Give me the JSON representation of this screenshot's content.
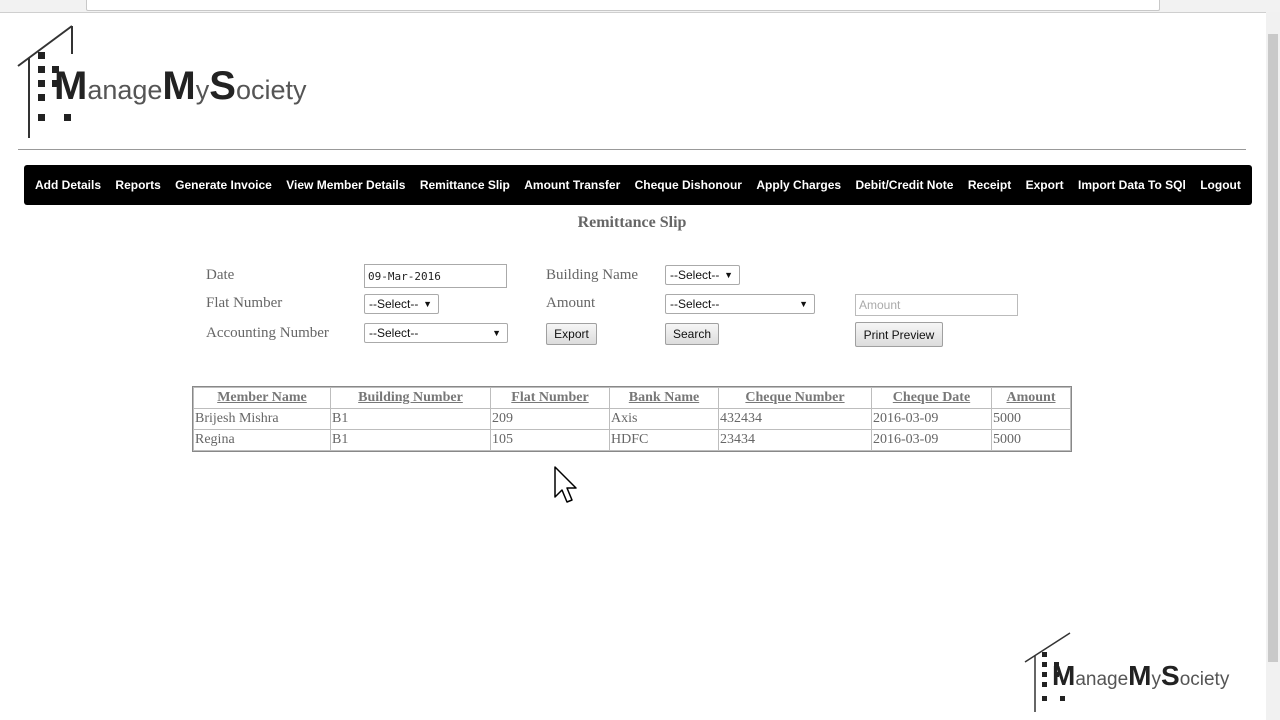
{
  "app": {
    "logo_part1": "anage",
    "logo_part2": "y",
    "logo_part3": "ociety"
  },
  "nav": {
    "items": [
      "Add Details",
      "Reports",
      "Generate Invoice",
      "View Member Details",
      "Remittance Slip",
      "Amount Transfer",
      "Cheque Dishonour",
      "Apply Charges",
      "Debit/Credit Note",
      "Receipt",
      "Export",
      "Import Data To SQl",
      "Logout"
    ]
  },
  "page": {
    "title": "Remittance Slip"
  },
  "form": {
    "date_label": "Date",
    "date_value": "09-Mar-2016",
    "building_label": "Building Name",
    "building_value": "--Select--",
    "flat_label": "Flat Number",
    "flat_value": "--Select--",
    "amount_label": "Amount",
    "amount_select_value": "--Select--",
    "amount_placeholder": "Amount",
    "accounting_label": "Accounting Number",
    "accounting_value": "--Select--",
    "export_label": "Export",
    "search_label": "Search",
    "print_label": "Print Preview"
  },
  "table": {
    "headers": [
      "Member Name",
      "Building Number",
      "Flat Number",
      "Bank Name",
      "Cheque Number",
      "Cheque Date",
      "Amount"
    ],
    "rows": [
      [
        "Brijesh Mishra",
        "B1",
        "209",
        "Axis",
        "432434",
        "2016-03-09",
        "5000"
      ],
      [
        "Regina",
        "B1",
        "105",
        "HDFC",
        "23434",
        "2016-03-09",
        "5000"
      ]
    ]
  },
  "colors": {
    "navbar_bg": "#000000",
    "nav_text": "#ffffff",
    "title_text": "#666666"
  }
}
